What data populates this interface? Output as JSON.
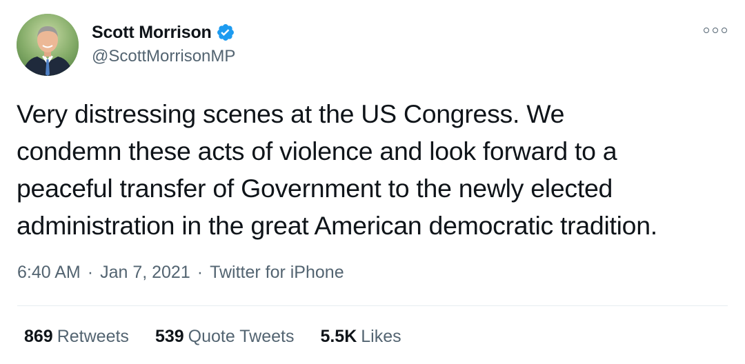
{
  "author": {
    "display_name": "Scott Morrison",
    "handle": "@ScottMorrisonMP",
    "verified": true,
    "verified_icon": "verified-badge-icon"
  },
  "tweet": {
    "lines": [
      "Very distressing scenes at the US Congress. We",
      "condemn these acts of violence and look forward to a",
      "peaceful transfer of Government to the newly elected",
      "administration in the great American democratic tradition."
    ]
  },
  "meta": {
    "time": "6:40 AM",
    "separator": "·",
    "date": "Jan 7, 2021",
    "source": "Twitter for iPhone"
  },
  "stats": {
    "retweets_count": "869",
    "retweets_label": "Retweets",
    "quotes_count": "539",
    "quotes_label": "Quote Tweets",
    "likes_count": "5.5K",
    "likes_label": "Likes"
  },
  "colors": {
    "primary_text": "#0f1419",
    "secondary_text": "#536471",
    "verified_blue": "#1d9bf0",
    "divider": "#e6ecf0"
  }
}
